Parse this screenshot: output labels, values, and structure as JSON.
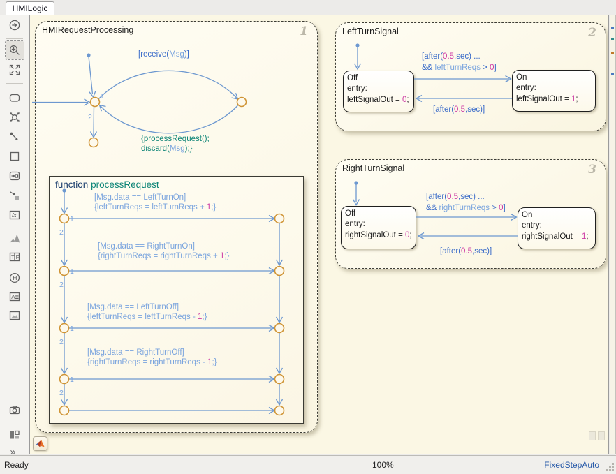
{
  "tab_title": "HMILogic",
  "status": {
    "ready": "Ready",
    "zoom": "100%",
    "solver": "FixedStepAuto"
  },
  "colors": {
    "canvas": "#fbf7e4",
    "keyword_blue": "#3b6cc9",
    "identifier_blue": "#7aa4de",
    "literal_magenta": "#cd3ba4",
    "function_teal": "#0f8577",
    "junction_orange": "#cf9435",
    "wire_blue": "#6d98d0",
    "solver_blue": "#2558a8"
  },
  "toolbar": {
    "icons": [
      "navigate-forward",
      "zoom-in",
      "fit-to-view",
      "state",
      "junction",
      "default-transition",
      "box",
      "simulink-state",
      "graphical-function",
      "matlab-function",
      "simulink-function",
      "truth-table",
      "history-junction",
      "annotation",
      "image",
      "screenshot",
      "pattern-wizard",
      "more-tools"
    ],
    "glyphs": {
      "fx": "fx",
      "t": "T",
      "f": "F",
      "h": "H",
      "a": "A",
      "more": "»"
    }
  },
  "hmi": {
    "title": "HMIRequestProcessing",
    "badge": "1",
    "receive": {
      "a": "[receive(",
      "b": "Msg",
      "c": ")]"
    },
    "action": {
      "line1": "{processRequest();",
      "d1": "discard(",
      "d2": "Msg",
      "d3": ");}"
    },
    "order1": "1",
    "order2": "2"
  },
  "fn": {
    "kw": "function",
    "name": "processRequest",
    "order1": "1",
    "order2": "2",
    "rows": [
      {
        "cond": "[Msg.data == LeftTurnOn]",
        "a": "{leftTurnReqs = leftTurnReqs + ",
        "n": "1",
        "z": ";}"
      },
      {
        "cond": "[Msg.data == RightTurnOn]",
        "a": "{rightTurnReqs = rightTurnReqs + ",
        "n": "1",
        "z": ";}"
      },
      {
        "cond": "[Msg.data == LeftTurnOff]",
        "a": "{leftTurnReqs = leftTurnReqs - ",
        "n": "1",
        "z": ";}"
      },
      {
        "cond": "[Msg.data == RightTurnOff]",
        "a": "{rightTurnReqs = rightTurnReqs - ",
        "n": "1",
        "z": ";}"
      }
    ]
  },
  "lts": {
    "title": "LeftTurnSignal",
    "badge": "2",
    "off": {
      "name": "Off",
      "entry": "entry:",
      "a": "leftSignalOut = ",
      "n": "0",
      "z": ";"
    },
    "on": {
      "name": "On",
      "entry": "entry:",
      "a": "leftSignalOut = ",
      "n": "1",
      "z": ";"
    },
    "t1": {
      "a": "[after(",
      "n": "0.5",
      "b": ",sec) ..."
    },
    "t2": {
      "a": "&& ",
      "b": "leftTurnReqs",
      "c": " > ",
      "n": "0",
      "z": "]"
    },
    "t3": {
      "a": "[after(",
      "n": "0.5",
      "b": ",sec)]"
    }
  },
  "rts": {
    "title": "RightTurnSignal",
    "badge": "3",
    "off": {
      "name": "Off",
      "entry": "entry:",
      "a": "rightSignalOut = ",
      "n": "0",
      "z": ";"
    },
    "on": {
      "name": "On",
      "entry": "entry:",
      "a": "rightSignalOut = ",
      "n": "1",
      "z": ";"
    },
    "t1": {
      "a": "[after(",
      "n": "0.5",
      "b": ",sec) ..."
    },
    "t2": {
      "a": "&& ",
      "b": "rightTurnReqs",
      "c": " > ",
      "n": "0",
      "z": "]"
    },
    "t3": {
      "a": "[after(",
      "n": "0.5",
      "b": ",sec)]"
    }
  }
}
